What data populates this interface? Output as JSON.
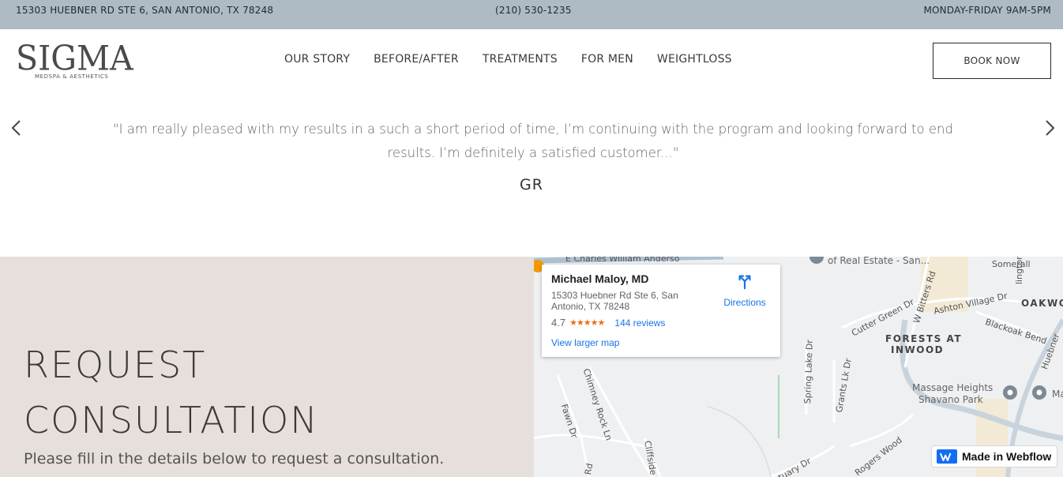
{
  "topbar": {
    "address": "15303 HUEBNER RD STE 6, SAN ANTONIO, TX 78248",
    "phone": "(210) 530-1235",
    "hours": "MONDAY-FRIDAY 9AM-5PM"
  },
  "header": {
    "logo_main": "SIGMA",
    "logo_sub": "MEDSPA & AESTHETICS",
    "nav": [
      "OUR STORY",
      "BEFORE/AFTER",
      "TREATMENTS",
      "FOR MEN",
      "WEIGHTLOSS"
    ],
    "book_label": "BOOK NOW"
  },
  "testimonial": {
    "quote": "\"I am really pleased with my results in a such a short period of time, I’m continuing with the program and looking forward to end results.  I’m definitely a satisfied customer...\"",
    "author": "GR"
  },
  "request": {
    "title_line1": "REQUEST",
    "title_line2": "CONSULTATION",
    "subtitle": "Please fill in the details below to request a consultation."
  },
  "map": {
    "place_name": "Michael Maloy, MD",
    "address": "15303 Huebner Rd Ste 6, San Antonio, TX 78248",
    "rating": "4.7",
    "rating_value": 4.7,
    "reviews": "144 reviews",
    "directions_label": "Directions",
    "larger_map_label": "View larger map",
    "labels": {
      "charles": "E Charles William Anderso",
      "realestate": "of Real Estate - San...",
      "somerall": "Somerall",
      "lington": "lington",
      "bitters": "W Bitters Rd",
      "cutter": "Cutter Green Dr",
      "ashton": "Ashton Village Dr",
      "oakwo": "OAKWO",
      "blackoak": "Blackoak Bend",
      "forests1": "FORESTS AT",
      "forests2": "INWOOD",
      "huebner": "Huebner",
      "spring": "Spring Lake Dr",
      "grants": "Grants Lk Dr",
      "chimney": "Chimney Rock Ln",
      "fawn": "Fawn Dr",
      "massage1": "Massage Heights",
      "massage2": "Shavano Park",
      "ma": "Ma",
      "cliffside": "Cliffside D",
      "rd": "Rd",
      "rogers": "Rogers Wood",
      "ctuary": "ctuary Dr"
    }
  },
  "webflow": {
    "label": "Made in Webflow"
  },
  "colors": {
    "topbar": "#aebbc4",
    "request_bg": "#e6dfdc",
    "link_blue": "#1a73e8",
    "star_orange": "#e7711b",
    "webflow_blue": "#146ef5"
  }
}
